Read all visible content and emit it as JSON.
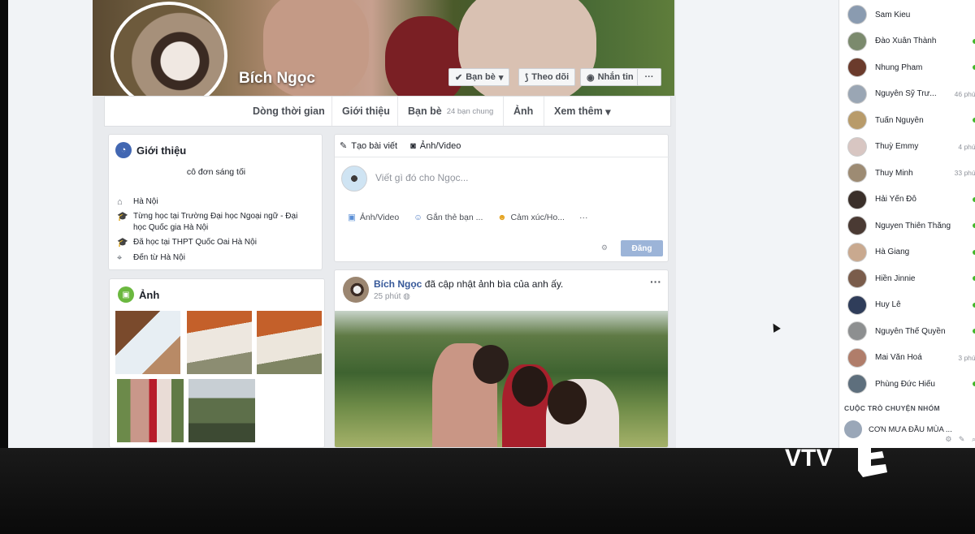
{
  "profile": {
    "name": "Bích Ngọc",
    "buttons": {
      "friends": "Bạn bè",
      "follow": "Theo dõi",
      "message": "Nhắn tin",
      "more": "···"
    }
  },
  "tabs": {
    "timeline": "Dòng thời gian",
    "about": "Giới thiệu",
    "friends": "Bạn bè",
    "friends_count": "24 bạn chung",
    "photos": "Ảnh",
    "more": "Xem thêm"
  },
  "intro": {
    "title": "Giới thiệu",
    "bio": "cô đơn sáng tối",
    "lives_in": "Hà Nội",
    "studies_at": "Từng học tại Trường Đại học Ngoại ngữ - Đại học Quốc gia Hà Nội",
    "high_school": "Đã học tại THPT Quốc Oai Hà Nội",
    "from": "Đến từ Hà Nội"
  },
  "photos_card": {
    "title": "Ảnh"
  },
  "composer": {
    "create_post": "Tạo bài viết",
    "photo_video": "Ảnh/Video",
    "placeholder": "Viết gì đó cho Ngọc...",
    "action_photo": "Ảnh/Video",
    "action_tag": "Gắn thẻ bạn ...",
    "action_feeling": "Cảm xúc/Ho...",
    "action_more": "···",
    "post_button": "Đăng",
    "audience": "⚙"
  },
  "post": {
    "author": "Bích Ngọc",
    "action": "đã cập nhật ảnh bìa của anh ấy.",
    "time": "25 phút",
    "menu": "···"
  },
  "chat": {
    "contacts": [
      {
        "name": "Sam Kieu",
        "status": "",
        "online": false,
        "color": "#8a9bb0"
      },
      {
        "name": "Đào Xuân Thành",
        "status": "",
        "online": true,
        "color": "#7b8a6d"
      },
      {
        "name": "Nhung Pham",
        "status": "",
        "online": true,
        "color": "#6b3b2c"
      },
      {
        "name": "Nguyễn Sỹ Trư...",
        "status": "46 phút",
        "online": false,
        "color": "#9aa6b4"
      },
      {
        "name": "Tuấn Nguyễn",
        "status": "",
        "online": true,
        "color": "#b89b6a"
      },
      {
        "name": "Thuỳ Emmy",
        "status": "4 phút",
        "online": false,
        "color": "#d8c6c2"
      },
      {
        "name": "Thuy Minh",
        "status": "33 phút",
        "online": false,
        "color": "#9d8b73"
      },
      {
        "name": "Hải Yến Đỗ",
        "status": "",
        "online": true,
        "color": "#3a2f2a"
      },
      {
        "name": "Nguyen Thiên Thắng",
        "status": "",
        "online": true,
        "color": "#4a3a33"
      },
      {
        "name": "Hà Giang",
        "status": "",
        "online": true,
        "color": "#c9a98f"
      },
      {
        "name": "Hiền Jinnie",
        "status": "",
        "online": true,
        "color": "#7a5c4b"
      },
      {
        "name": "Huy Lê",
        "status": "",
        "online": true,
        "color": "#2f3d5a"
      },
      {
        "name": "Nguyễn Thế Quyền",
        "status": "",
        "online": true,
        "color": "#8d8f90"
      },
      {
        "name": "Mai Văn Hoá",
        "status": "3 phút",
        "online": false,
        "color": "#b07d6a"
      },
      {
        "name": "Phùng Đức Hiếu",
        "status": "",
        "online": true,
        "color": "#5e6f7d"
      }
    ],
    "section_title": "CUỘC TRÒ CHUYỆN NHÓM",
    "group_name": "CƠN MƯA ĐẦU MÙA ...",
    "tools": "⚙ ✎ ⌕"
  },
  "watermark": {
    "text": "VTV"
  }
}
